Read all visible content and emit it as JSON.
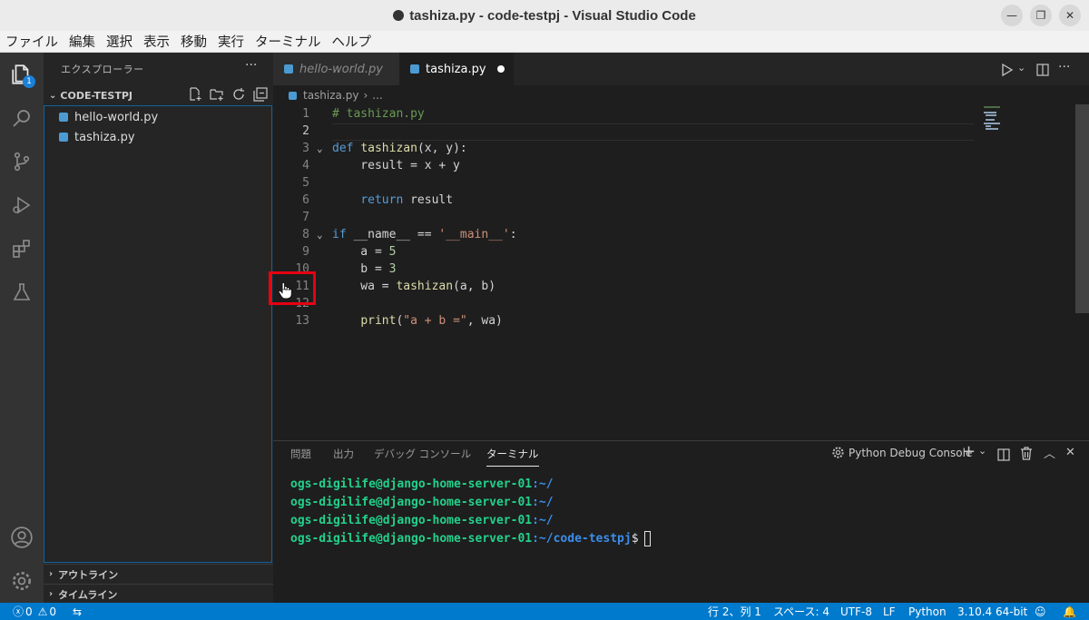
{
  "window": {
    "title": "tashiza.py - code-testpj - Visual Studio Code"
  },
  "menu": [
    "ファイル",
    "編集",
    "選択",
    "表示",
    "移動",
    "実行",
    "ターミナル",
    "ヘルプ"
  ],
  "activity_bar": {
    "explorer_badge": "1"
  },
  "sidebar": {
    "title": "エクスプローラー",
    "more": "···",
    "folder": "CODE-TESTPJ",
    "files": [
      "hello-world.py",
      "tashiza.py"
    ],
    "sections": [
      "アウトライン",
      "タイムライン"
    ]
  },
  "tabs": [
    {
      "label": "hello-world.py",
      "active": false
    },
    {
      "label": "tashiza.py",
      "active": true,
      "modified": true
    }
  ],
  "breadcrumb": {
    "file": "tashiza.py",
    "rest": "..."
  },
  "editor": {
    "line_numbers": [
      "1",
      "2",
      "3",
      "4",
      "5",
      "6",
      "7",
      "8",
      "9",
      "10",
      "11",
      "12",
      "13"
    ],
    "lines": [
      "# tashizan.py",
      "",
      "def tashizan(x, y):",
      "    result = x + y",
      "",
      "    return result",
      "",
      "if __name__ == '__main__':",
      "    a = 5",
      "    b = 3",
      "    wa = tashizan(a, b)",
      "",
      "    print(\"a + b =\", wa)"
    ]
  },
  "panel": {
    "tabs": [
      "問題",
      "出力",
      "デバッグ コンソール",
      "ターミナル"
    ],
    "active_tab": "ターミナル",
    "console_selector": "Python Debug Console",
    "terminal": [
      {
        "user": "ogs-digilife@django-home-server-01",
        "path": ":~/",
        "prompt": ""
      },
      {
        "user": "ogs-digilife@django-home-server-01",
        "path": ":~/",
        "prompt": ""
      },
      {
        "user": "ogs-digilife@django-home-server-01",
        "path": ":~/",
        "prompt": ""
      },
      {
        "user": "ogs-digilife@django-home-server-01",
        "path": ":~/code-testpj",
        "prompt": "$"
      }
    ]
  },
  "status": {
    "errors": "0",
    "warnings": "0",
    "position": "行 2、列 1",
    "spaces": "スペース: 4",
    "encoding": "UTF-8",
    "eol": "LF",
    "language": "Python",
    "interpreter": "3.10.4 64-bit"
  },
  "colors": {
    "statusbar": "#007acc",
    "highlight_box": "#e60012",
    "accent": "#0e639c"
  }
}
